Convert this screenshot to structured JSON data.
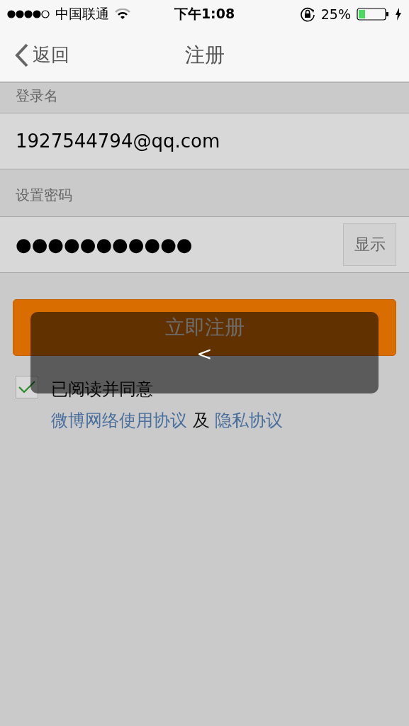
{
  "status_bar": {
    "carrier": "中国联通",
    "time": "下午1:08",
    "battery": "25%"
  },
  "nav": {
    "back": "返回",
    "title": "注册"
  },
  "fields": [
    {
      "label": "登录名",
      "value": "1927544794@qq.com"
    },
    {
      "label": "设置密码",
      "value": "●●●●●●●●●●●",
      "show_button": "显示"
    }
  ],
  "submit": "立即注册",
  "agreement": {
    "checked": true,
    "text": "已阅读并同意",
    "link_1": "微博网络使用协议",
    "joiner": "及",
    "link_2": "隐私协议"
  },
  "toast": {
    "text": "<"
  }
}
